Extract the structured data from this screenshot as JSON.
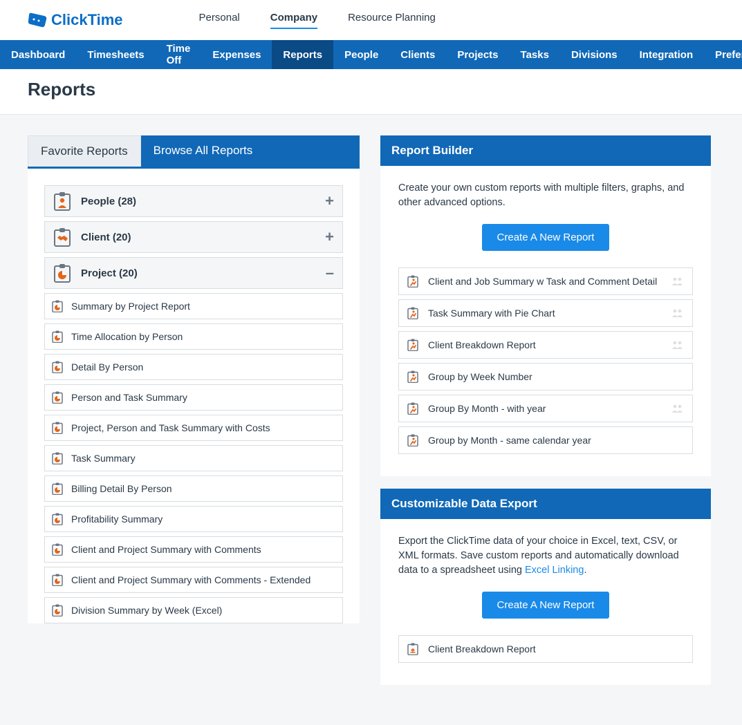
{
  "logo_text": "ClickTime",
  "topnav": [
    {
      "label": "Personal",
      "active": false
    },
    {
      "label": "Company",
      "active": true
    },
    {
      "label": "Resource Planning",
      "active": false
    }
  ],
  "subnav": [
    {
      "label": "Dashboard",
      "active": false
    },
    {
      "label": "Timesheets",
      "active": false
    },
    {
      "label": "Time Off",
      "active": false
    },
    {
      "label": "Expenses",
      "active": false
    },
    {
      "label": "Reports",
      "active": true
    },
    {
      "label": "People",
      "active": false
    },
    {
      "label": "Clients",
      "active": false
    },
    {
      "label": "Projects",
      "active": false
    },
    {
      "label": "Tasks",
      "active": false
    },
    {
      "label": "Divisions",
      "active": false
    },
    {
      "label": "Integration",
      "active": false
    },
    {
      "label": "Preferences",
      "active": false
    }
  ],
  "page_title": "Reports",
  "tabs": {
    "favorite": "Favorite Reports",
    "browse": "Browse All Reports"
  },
  "groups": [
    {
      "label": "People (28)",
      "icon": "person",
      "expanded": false
    },
    {
      "label": "Client (20)",
      "icon": "handshake",
      "expanded": false
    },
    {
      "label": "Project (20)",
      "icon": "piechart",
      "expanded": true
    }
  ],
  "project_reports": [
    "Summary by Project Report",
    "Time Allocation by Person",
    "Detail By Person",
    "Person and Task Summary",
    "Project, Person and Task Summary with Costs",
    "Task Summary",
    "Billing Detail By Person",
    "Profitability Summary",
    "Client and Project Summary with Comments",
    "Client and Project Summary with Comments - Extended",
    "Division Summary by Week (Excel)"
  ],
  "report_builder": {
    "title": "Report Builder",
    "desc": "Create your own custom reports with multiple filters, graphs, and other advanced options.",
    "button": "Create A New Report",
    "items": [
      {
        "label": "Client and Job Summary w Task and Comment Detail",
        "shared": true
      },
      {
        "label": "Task Summary with Pie Chart",
        "shared": true
      },
      {
        "label": "Client Breakdown Report",
        "shared": true
      },
      {
        "label": "Group by Week Number",
        "shared": false
      },
      {
        "label": "Group By Month - with year",
        "shared": true
      },
      {
        "label": "Group by Month - same calendar year",
        "shared": false
      }
    ]
  },
  "data_export": {
    "title": "Customizable Data Export",
    "desc_pre": "Export the ClickTime data of your choice in Excel, text, CSV, or XML formats. Save custom reports and automatically download data to a spreadsheet using ",
    "link": "Excel Linking",
    "desc_post": ".",
    "button": "Create A New Report",
    "items": [
      {
        "label": "Client Breakdown Report"
      }
    ]
  }
}
